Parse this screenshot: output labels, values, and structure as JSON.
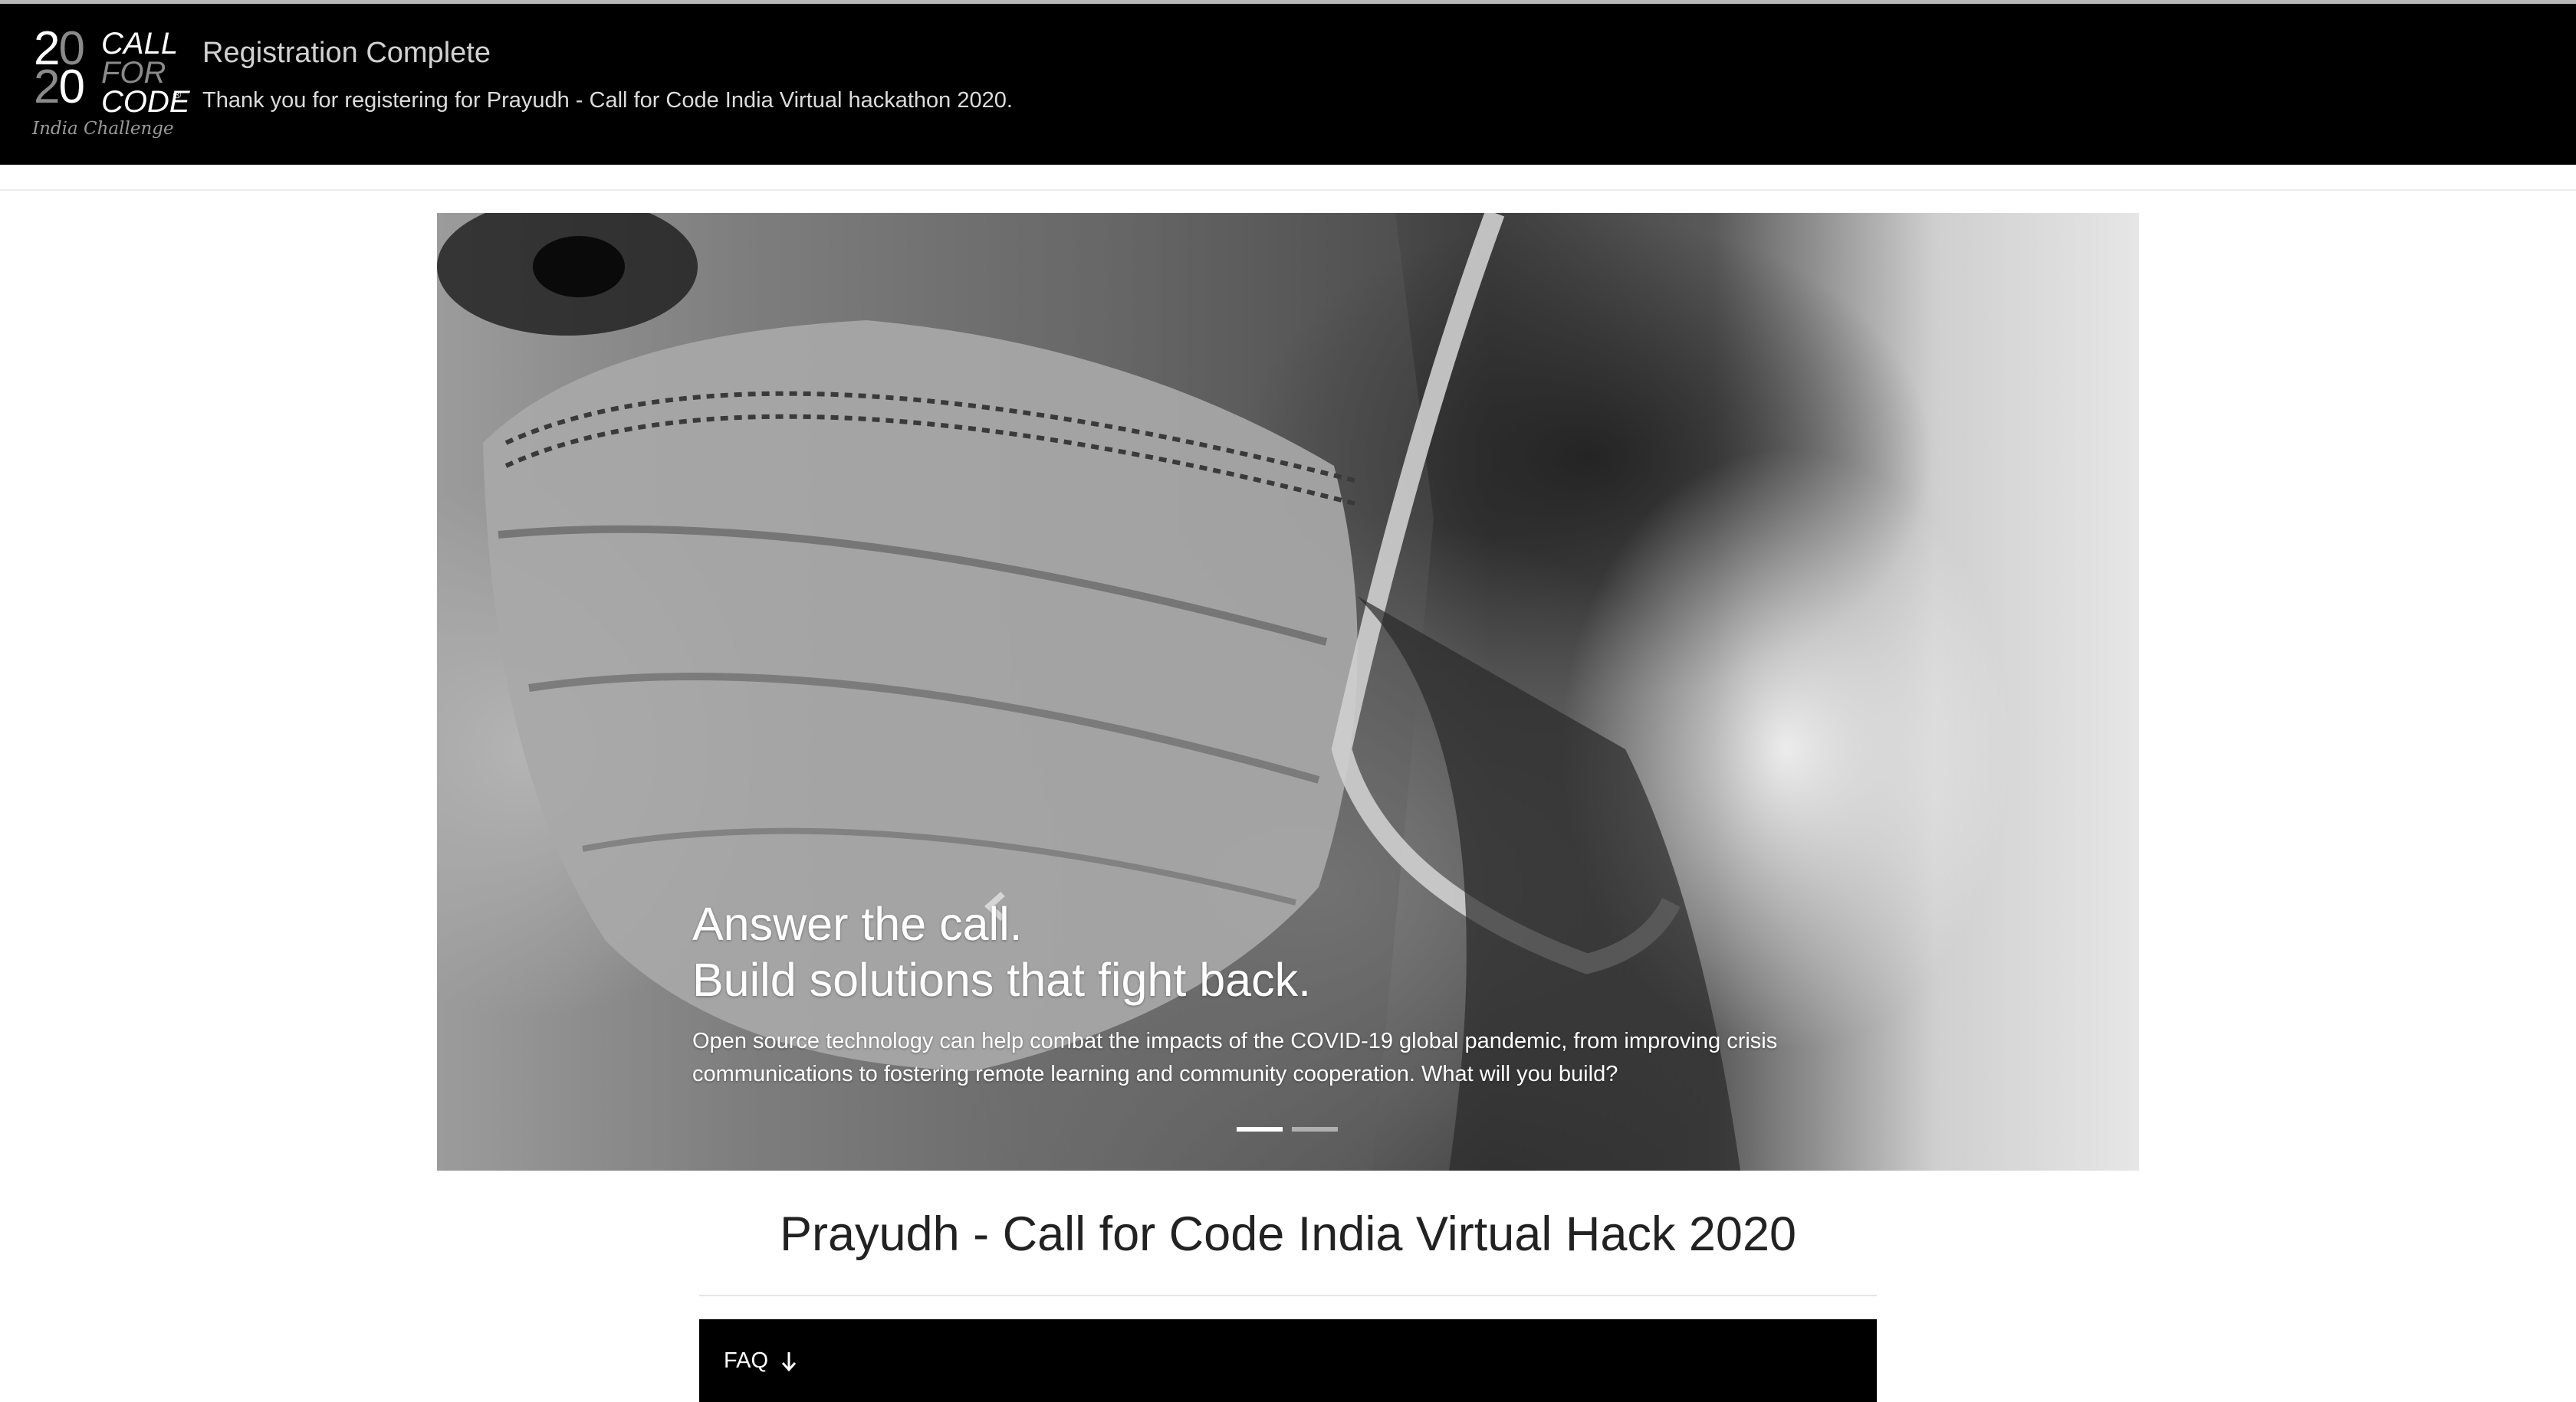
{
  "header": {
    "logo": {
      "num_top": "20",
      "num_bottom": "20",
      "word1": "CALL",
      "word2": "FOR",
      "word3": "CODE",
      "registered": "®",
      "subtitle": "India Challenge"
    },
    "title": "Registration Complete",
    "subtitle": "Thank you for registering for Prayudh - Call for Code India Virtual hackathon 2020."
  },
  "carousel": {
    "caption_line1": "Answer the call.",
    "caption_line2": "Build solutions that fight back.",
    "caption_body": "Open source technology can help combat the impacts of the COVID-19 global pandemic, from improving crisis communications to fostering remote learning and community cooperation. What will you build?",
    "slide_count": 2,
    "active_slide": 1,
    "prev_icon": "chevron-left-icon",
    "next_icon": "chevron-right-icon"
  },
  "main": {
    "title": "Prayudh - Call for Code India Virtual Hack 2020",
    "faq_label": "FAQ",
    "faq_icon": "arrow-down-icon"
  },
  "colors": {
    "header_bg": "#000000",
    "faq_bg": "#000000",
    "title_text": "#222222"
  }
}
